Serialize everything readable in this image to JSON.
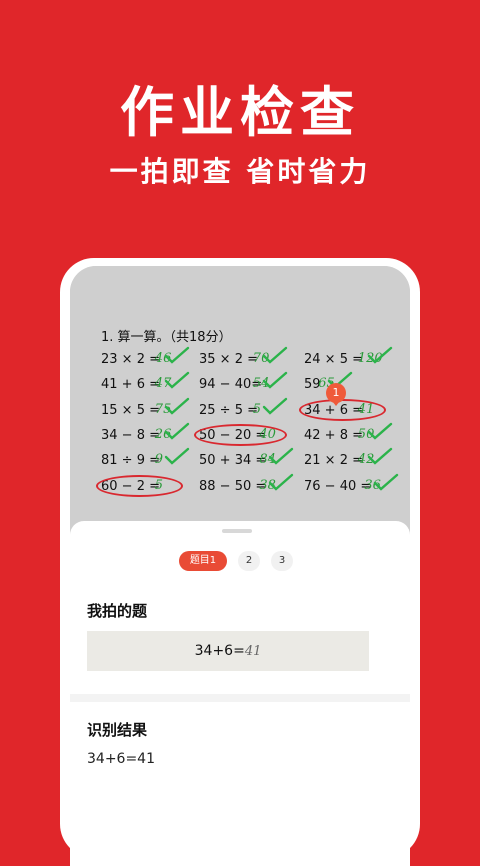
{
  "promo": {
    "title": "作业检查",
    "subtitle": "一拍即查  省时省力"
  },
  "worksheet": {
    "question_title": "1. 算一算。（共18分）",
    "problems": [
      {
        "text": "23 × 2 =",
        "answer": "46",
        "correct": true
      },
      {
        "text": "35 × 2 =",
        "answer": "70",
        "correct": true
      },
      {
        "text": "24 × 5 =",
        "answer": "120",
        "correct": true
      },
      {
        "text": "41 + 6 =",
        "answer": "47",
        "correct": true
      },
      {
        "text": "94 − 40=",
        "answer": "54",
        "correct": true
      },
      {
        "text": "59",
        "answer": "65",
        "correct": true
      },
      {
        "text": "15 × 5 =",
        "answer": "75",
        "correct": true
      },
      {
        "text": "25 ÷ 5 =",
        "answer": "5",
        "correct": true
      },
      {
        "text": "34 + 6 =",
        "answer": "41",
        "correct": false
      },
      {
        "text": "34 − 8 =",
        "answer": "26",
        "correct": true
      },
      {
        "text": "50 − 20 =",
        "answer": "40",
        "correct": false
      },
      {
        "text": "42 + 8 =",
        "answer": "50",
        "correct": true
      },
      {
        "text": "81 ÷ 9 =",
        "answer": "9",
        "correct": true
      },
      {
        "text": "50 + 34 =",
        "answer": "84",
        "correct": true
      },
      {
        "text": "21 × 2 =",
        "answer": "42",
        "correct": true
      },
      {
        "text": "60 − 2 =",
        "answer": "5",
        "correct": false
      },
      {
        "text": "88 − 50 =",
        "answer": "38",
        "correct": true
      },
      {
        "text": "76 − 40 =",
        "answer": "36",
        "correct": true
      }
    ],
    "marker_number": "1"
  },
  "sheet": {
    "tabs": [
      {
        "label": "题目1",
        "active": true
      },
      {
        "label": "2",
        "active": false
      },
      {
        "label": "3",
        "active": false
      }
    ],
    "my_photo_title": "我拍的题",
    "my_photo_expression": "34+6=",
    "my_photo_answer": "41",
    "result_title": "识别结果",
    "result_text": "34+6=41"
  },
  "colors": {
    "brand_red": "#e0262a",
    "error_red": "#d9282f",
    "check_green": "#2bb34a",
    "active_tab": "#e94b35"
  },
  "icons": {
    "correct_mark": "check-icon"
  }
}
